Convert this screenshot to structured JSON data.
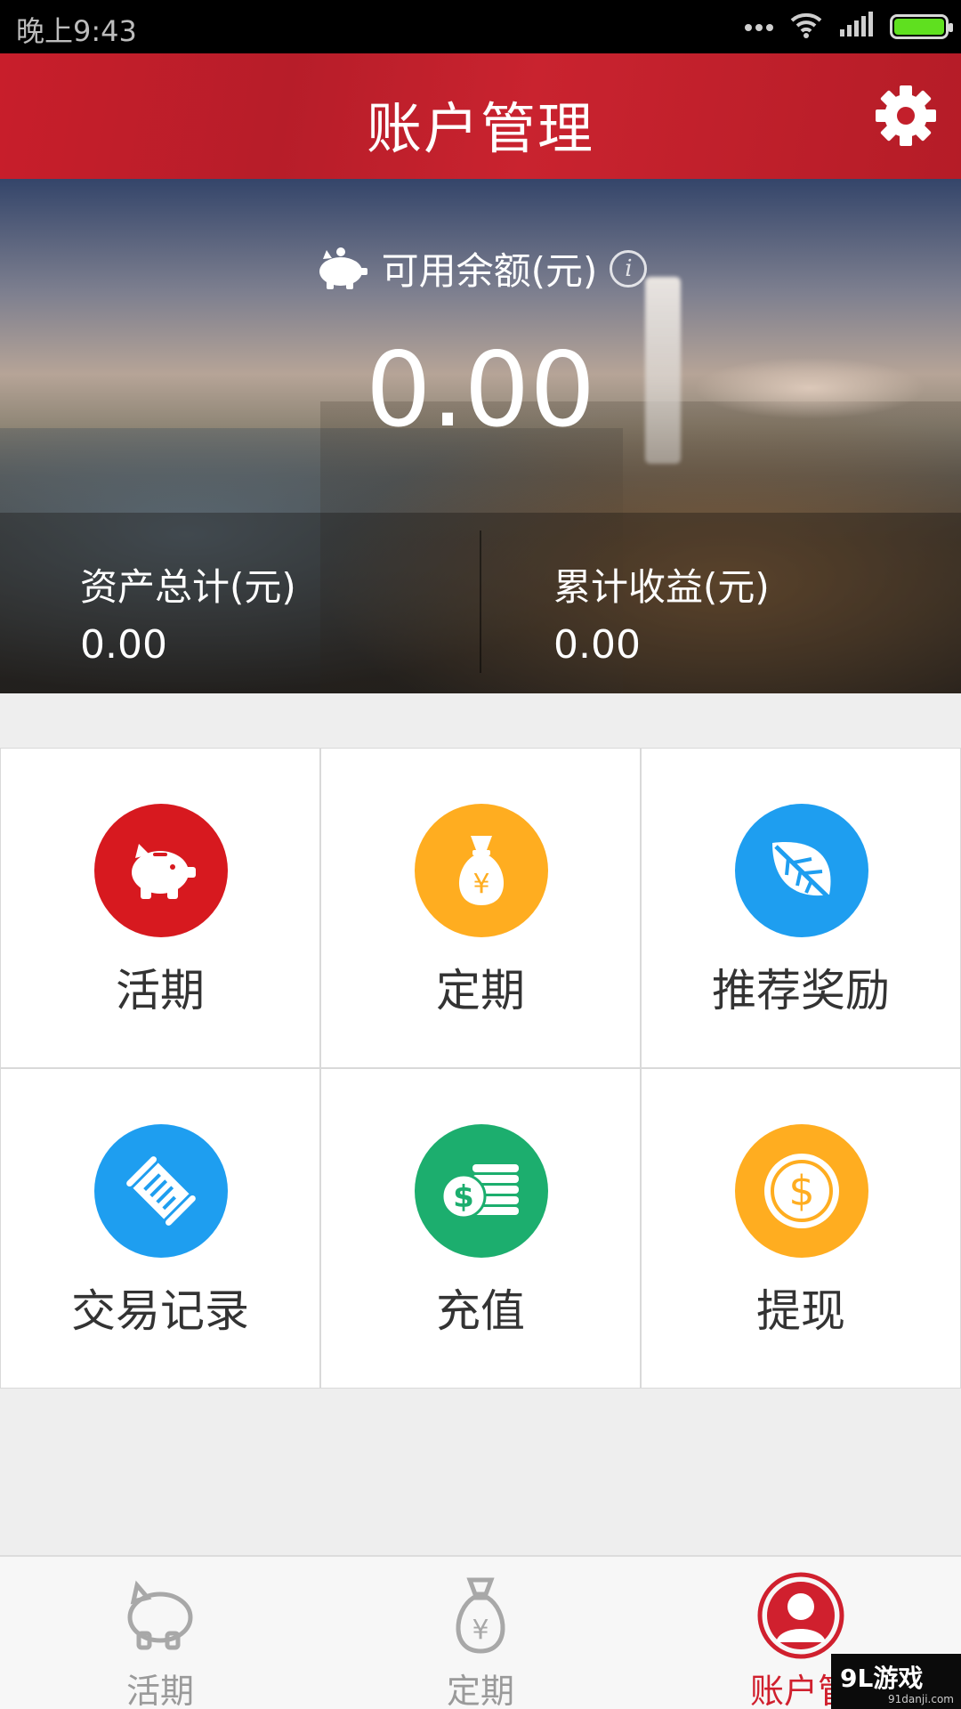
{
  "status_bar": {
    "time": "晚上9:43",
    "icons": [
      "more-icon",
      "wifi-icon",
      "signal-icon",
      "battery-icon"
    ],
    "battery_color": "#5fe01f"
  },
  "header": {
    "title": "账户管理",
    "settings_icon": "gear-icon",
    "color": "#c31f2b"
  },
  "summary": {
    "balance_label": "可用余额(元)",
    "balance_value": "0.00",
    "total_assets_label": "资产总计(元)",
    "total_assets_value": "0.00",
    "cumulative_income_label": "累计收益(元)",
    "cumulative_income_value": "0.00"
  },
  "menu": [
    {
      "label": "活期",
      "icon": "piggy-bank-icon",
      "color": "#d7191f"
    },
    {
      "label": "定期",
      "icon": "money-bag-icon",
      "color": "#ffad20"
    },
    {
      "label": "推荐奖励",
      "icon": "leaf-icon",
      "color": "#1e9ef0"
    },
    {
      "label": "交易记录",
      "icon": "scroll-icon",
      "color": "#1e9ef0"
    },
    {
      "label": "充值",
      "icon": "coins-icon",
      "color": "#1cae6e"
    },
    {
      "label": "提现",
      "icon": "dollar-coin-icon",
      "color": "#ffad20"
    }
  ],
  "bottom_nav": [
    {
      "label": "活期",
      "icon": "piggy-bank-icon",
      "active": false
    },
    {
      "label": "定期",
      "icon": "money-bag-icon",
      "active": false
    },
    {
      "label": "账户管",
      "icon": "user-icon",
      "active": true
    }
  ],
  "watermark": {
    "brand": "9L游戏",
    "site": "91danji.com"
  }
}
